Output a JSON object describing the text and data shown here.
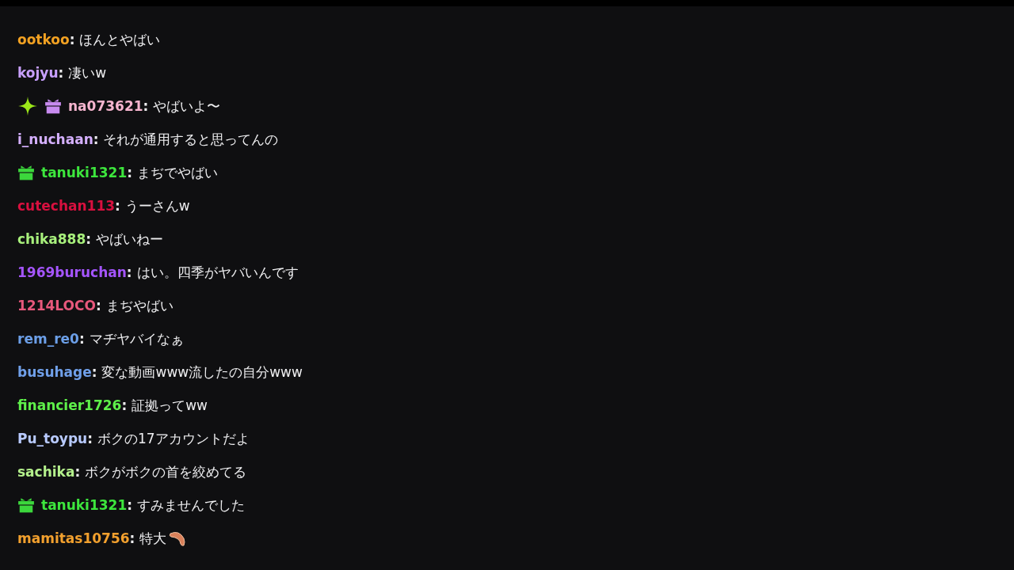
{
  "messages": [
    {
      "user": "ootkoo",
      "color": "#f2a122",
      "separator": ":",
      "text": "ほんとやばい"
    },
    {
      "user": "kojyu",
      "color": "#c8a0ff",
      "separator": ":",
      "text": "凄いw"
    },
    {
      "user": "na073621",
      "color": "#f6b5cf",
      "badges": [
        {
          "kind": "sparkle",
          "color": "#9be619"
        },
        {
          "kind": "gift",
          "color": "#c88bf0"
        }
      ],
      "separator": ":",
      "text": "やばいよ〜"
    },
    {
      "user": "i_nuchaan",
      "color": "#d5b0ff",
      "separator": ":",
      "text": "それが通用すると思ってんの"
    },
    {
      "user": "tanuki1321",
      "color": "#3de63d",
      "badges": [
        {
          "kind": "gift",
          "color": "#3cd73c"
        }
      ],
      "separator": ":",
      "text": "まぢでやばい"
    },
    {
      "user": "cutechan113",
      "color": "#d8103f",
      "separator": ":",
      "text": "うーさんw"
    },
    {
      "user": "chika888",
      "color": "#a8f07c",
      "separator": ":",
      "text": "やばいねー"
    },
    {
      "user": "1969buruchan",
      "color": "#a555ff",
      "separator": ":",
      "text": "はい。四季がヤバいんです"
    },
    {
      "user": "1214LOCO",
      "color": "#e8587c",
      "separator": ":",
      "text": "まぢやばい"
    },
    {
      "user": "rem_re0",
      "color": "#6c9fe8",
      "separator": ":",
      "text": "マヂヤバイなぁ"
    },
    {
      "user": "busuhage",
      "color": "#70a0ea",
      "separator": ":",
      "text": "変な動画www流したの自分www"
    },
    {
      "user": "financier1726",
      "color": "#5ef04a",
      "separator": ":",
      "text": "証拠ってww"
    },
    {
      "user": "Pu_toypu",
      "color": "#b8caff",
      "separator": ":",
      "text": "ボクの17アカウントだよ"
    },
    {
      "user": "sachika",
      "color": "#b4f08c",
      "separator": ":",
      "text": "ボクがボクの首を絞めてる"
    },
    {
      "user": "tanuki1321",
      "color": "#3de63d",
      "badges": [
        {
          "kind": "gift",
          "color": "#3cd73c"
        }
      ],
      "separator": ":",
      "text": "すみませんでした"
    },
    {
      "user": "mamitas10756",
      "color": "#f2a02e",
      "separator": ":",
      "text": "特大",
      "emote": true
    }
  ]
}
